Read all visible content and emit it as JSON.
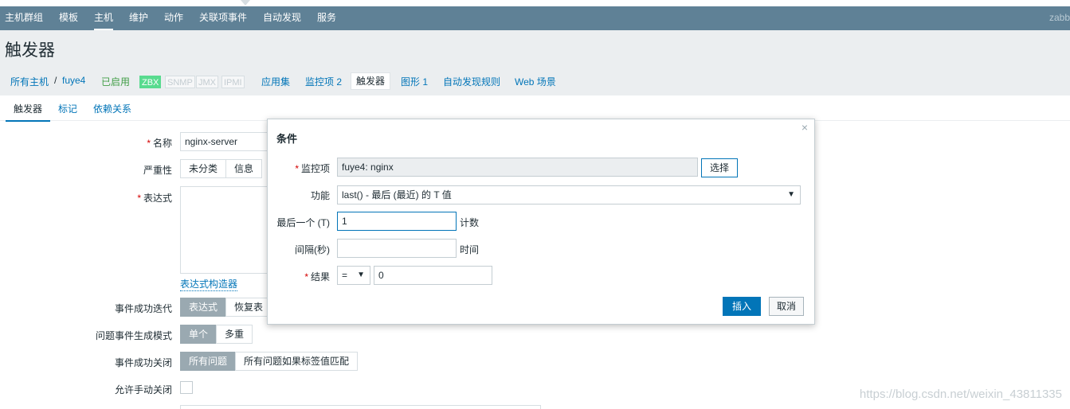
{
  "topnav": {
    "items": [
      "主机群组",
      "模板",
      "主机",
      "维护",
      "动作",
      "关联项事件",
      "自动发现",
      "服务"
    ],
    "active_index": 2,
    "brand": "zabb"
  },
  "page": {
    "title": "触发器"
  },
  "breadcrumb": {
    "all_hosts": "所有主机",
    "separator": "/",
    "host": "fuye4",
    "status": "已启用",
    "tags": [
      "ZBX",
      "SNMP",
      "JMX",
      "IPMI"
    ],
    "links": [
      "应用集",
      "监控项 2",
      "触发器",
      "图形 1",
      "自动发现规则",
      "Web 场景"
    ],
    "current_index": 2
  },
  "tabs": [
    "触发器",
    "标记",
    "依赖关系"
  ],
  "form": {
    "name_label": "名称",
    "name_value": "nginx-server",
    "severity_label": "严重性",
    "severity_options": [
      "未分类",
      "信息"
    ],
    "expression_label": "表达式",
    "expression_builder_link": "表达式构造器",
    "ok_event_label": "事件成功迭代",
    "ok_event_options": [
      "表达式",
      "恢复表"
    ],
    "problem_mode_label": "问题事件生成模式",
    "problem_mode_options": [
      "单个",
      "多重"
    ],
    "ok_close_label": "事件成功关闭",
    "ok_close_options": [
      "所有问题",
      "所有问题如果标签值匹配"
    ],
    "manual_close_label": "允许手动关闭"
  },
  "dialog": {
    "title": "条件",
    "close_icon": "close-icon",
    "item_label": "监控项",
    "item_value": "fuye4: nginx",
    "select_button": "选择",
    "function_label": "功能",
    "function_value": "last() - 最后 (最近) 的 T 值",
    "last_label": "最后一个 (T)",
    "last_value": "1",
    "last_unit": "计数",
    "interval_label": "间隔(秒)",
    "interval_value": "",
    "interval_unit": "时间",
    "result_label": "结果",
    "result_operator": "=",
    "result_value": "0",
    "insert_button": "插入",
    "cancel_button": "取消"
  },
  "watermark": "https://blog.csdn.net/weixin_43811335"
}
